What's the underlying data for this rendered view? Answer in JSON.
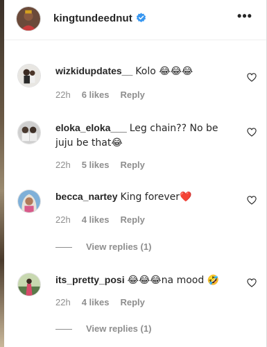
{
  "post": {
    "username": "kingtundeednut",
    "verified": true,
    "more_label": "•••"
  },
  "comments": [
    {
      "username": "wizkidupdates__",
      "text": "Kolo 😂😂😂",
      "time": "22h",
      "likes": "6 likes",
      "reply": "Reply"
    },
    {
      "username": "eloka_eloka___",
      "text": "Leg chain?? No be juju be that😂",
      "time": "22h",
      "likes": "5 likes",
      "reply": "Reply"
    },
    {
      "username": "becca_nartey",
      "text": "King forever❤️",
      "time": "22h",
      "likes": "4 likes",
      "reply": "Reply",
      "view_replies": "View replies (1)"
    },
    {
      "username": "its_pretty_posi",
      "text": "😂😂😂na mood 🤣",
      "time": "22h",
      "likes": "4 likes",
      "reply": "Reply",
      "view_replies": "View replies (1)"
    }
  ],
  "colors": {
    "verified_blue": "#3897f0",
    "meta_gray": "#8e8e8e",
    "text": "#262626"
  }
}
